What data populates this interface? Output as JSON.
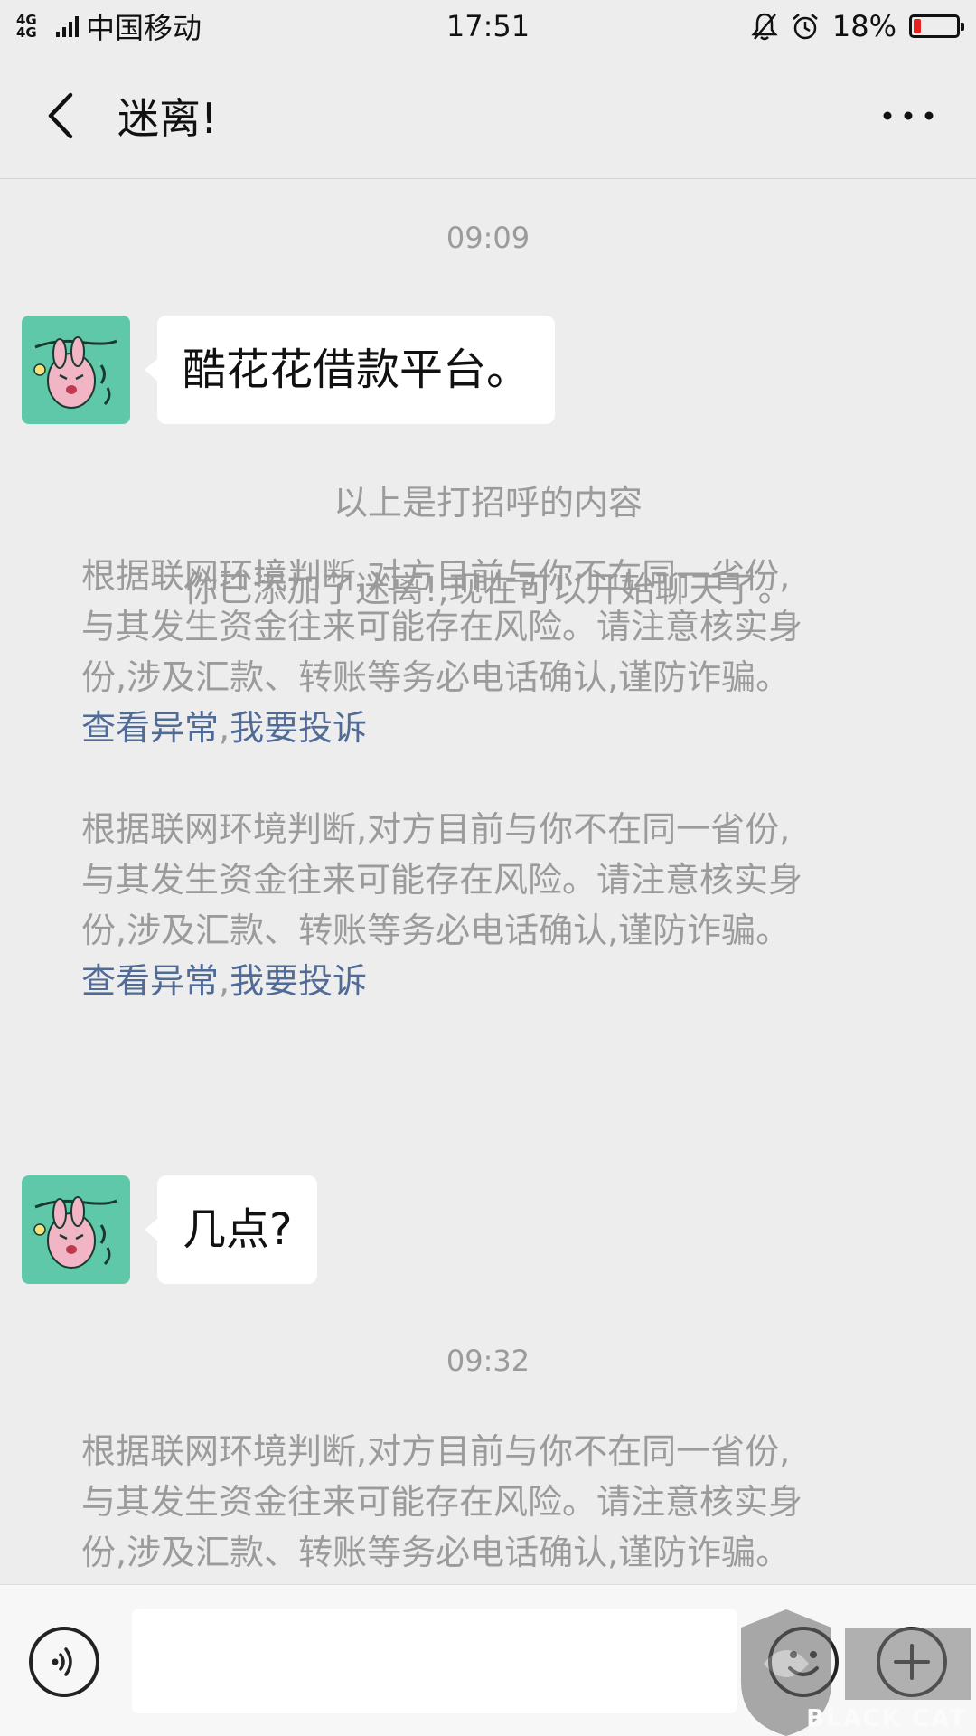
{
  "status_bar": {
    "network": "4G 4G",
    "carrier": "中国移动",
    "time": "17:51",
    "battery_percent": "18%",
    "battery_level": 0.18,
    "battery_color": "#e52222"
  },
  "header": {
    "title": "迷离!",
    "back_icon": "chevron-left-icon",
    "more_icon": "more-dots-icon"
  },
  "chat": {
    "timestamps": [
      "09:09",
      "09:32"
    ],
    "messages": [
      {
        "sender": "contact",
        "text": "酷花花借款平台。"
      },
      {
        "sender": "contact",
        "text": "几点?"
      }
    ],
    "system_notices": [
      "以上是打招呼的内容",
      "你已添加了迷离!,现在可以开始聊天了。"
    ],
    "warning": {
      "lines": [
        "根据联网环境判断,对方目前与你不在同一省份,",
        "与其发生资金往来可能存在风险。请注意核实身",
        "份,涉及汇款、转账等务必电话确认,谨防诈骗。"
      ],
      "link_view": "查看异常",
      "separator": ",",
      "link_report": "我要投诉"
    }
  },
  "input_bar": {
    "voice_icon": "voice-icon",
    "input_value": "",
    "emoji_icon": "emoji-icon",
    "plus_icon": "plus-icon"
  },
  "watermark": {
    "text": "BLACK CAT"
  },
  "colors": {
    "background": "#ededed",
    "bubble": "#ffffff",
    "link": "#4f6b96",
    "muted_text": "#9b9b9b"
  }
}
